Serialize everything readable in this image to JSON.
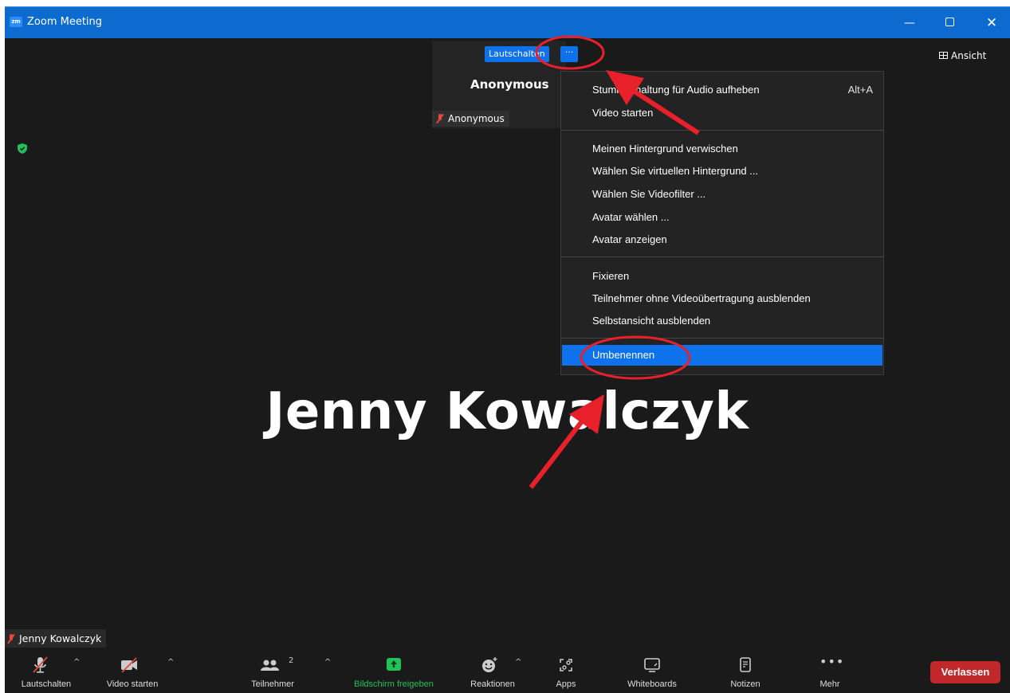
{
  "window": {
    "logo_text": "zm",
    "title": "Zoom Meeting",
    "minimize_glyph": "—",
    "close_glyph": "✕"
  },
  "view_button": {
    "label": "Ansicht"
  },
  "self_tile": {
    "unmute_label": "Lautschalten",
    "more_label": "···",
    "name": "Anonymous",
    "label": "Anonymous"
  },
  "main_video": {
    "name": "Jenny Kowalczyk",
    "label": "Jenny Kowalczyk"
  },
  "menu": {
    "items": [
      {
        "label": "Stummschaltung für Audio aufheben",
        "shortcut": "Alt+A"
      },
      {
        "label": "Video starten"
      },
      {
        "label": "Meinen Hintergrund verwischen"
      },
      {
        "label": "Wählen Sie virtuellen Hintergrund ..."
      },
      {
        "label": "Wählen Sie Videofilter ..."
      },
      {
        "label": "Avatar wählen ..."
      },
      {
        "label": "Avatar anzeigen"
      },
      {
        "label": "Fixieren"
      },
      {
        "label": "Teilnehmer ohne Videoübertragung ausblenden"
      },
      {
        "label": "Selbstansicht ausblenden"
      },
      {
        "label": "Umbenennen"
      }
    ],
    "selected_index": 10
  },
  "toolbar": {
    "mute_label": "Lautschalten",
    "video_label": "Video starten",
    "participants_label": "Teilnehmer",
    "participants_count": "2",
    "share_label": "Bildschirm freigeben",
    "reactions_label": "Reaktionen",
    "apps_label": "Apps",
    "whiteboards_label": "Whiteboards",
    "notes_label": "Notizen",
    "more_label": "Mehr",
    "leave_label": "Verlassen"
  },
  "colors": {
    "titlebar": "#0d6bcf",
    "accent_blue": "#0e72ed",
    "share_green": "#22c25a",
    "leave_red": "#c0282a",
    "annotation_red": "#e8202a",
    "muted_red": "#e8463c"
  }
}
